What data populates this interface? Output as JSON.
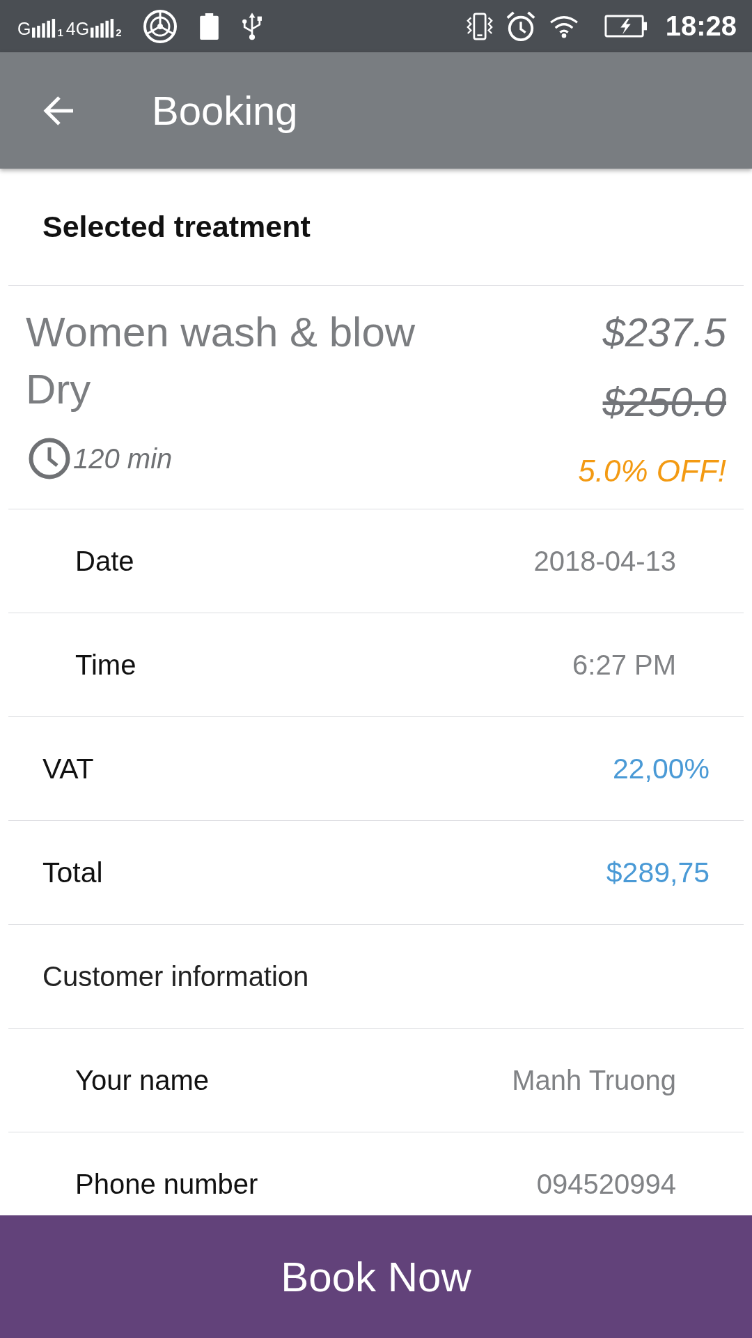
{
  "status_bar": {
    "signals": [
      {
        "network": "G",
        "sim": "1"
      },
      {
        "network": "4G",
        "sim": "2"
      }
    ],
    "time": "18:28"
  },
  "app_bar": {
    "title": "Booking"
  },
  "section": {
    "title": "Selected treatment"
  },
  "treatment": {
    "name": "Women wash & blow Dry",
    "duration": "120 min",
    "price": "$237.5",
    "original_price": "$250.0",
    "discount": "5.0% OFF!"
  },
  "rows": [
    {
      "kind": "detail",
      "label": "Date",
      "value": "2018-04-13"
    },
    {
      "kind": "detail",
      "label": "Time",
      "value": "6:27 PM"
    },
    {
      "kind": "summary",
      "label": "VAT",
      "value": "22,00%"
    },
    {
      "kind": "summary",
      "label": "Total",
      "value": "$289,75"
    },
    {
      "kind": "heading",
      "label": "Customer information"
    },
    {
      "kind": "detail",
      "label": "Your name",
      "value": "Manh Truong"
    },
    {
      "kind": "detail",
      "label": "Phone number",
      "value": "094520994"
    }
  ],
  "book_button": {
    "label": "Book Now"
  }
}
